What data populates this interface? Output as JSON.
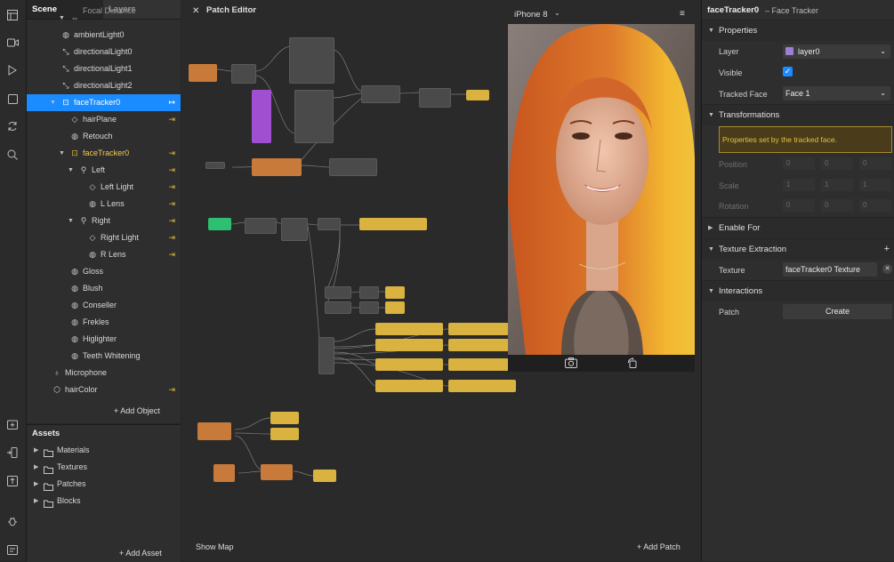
{
  "scene_panel": {
    "tabs": [
      "Scene",
      "Layers"
    ],
    "items": [
      {
        "label": "Focal Distance",
        "icon": "focal-icon"
      },
      {
        "label": "ambientLight0",
        "icon": "globe-icon"
      },
      {
        "label": "directionalLight0",
        "icon": "light-icon"
      },
      {
        "label": "directionalLight1",
        "icon": "light-icon"
      },
      {
        "label": "directionalLight2",
        "icon": "light-icon"
      },
      {
        "label": "faceTracker0",
        "icon": "face-tracker-icon"
      },
      {
        "label": "hairPlane",
        "icon": "plane-icon"
      },
      {
        "label": "Retouch",
        "icon": "globe-icon"
      },
      {
        "label": "faceTracker0",
        "icon": "face-tracker-icon"
      },
      {
        "label": "Left",
        "icon": "null-object-icon"
      },
      {
        "label": "Left Light",
        "icon": "plane-icon"
      },
      {
        "label": "L Lens",
        "icon": "globe-icon"
      },
      {
        "label": "Right",
        "icon": "null-object-icon"
      },
      {
        "label": "Right Light",
        "icon": "plane-icon"
      },
      {
        "label": "R Lens",
        "icon": "globe-icon"
      },
      {
        "label": "Gloss",
        "icon": "globe-icon"
      },
      {
        "label": "Blush",
        "icon": "globe-icon"
      },
      {
        "label": "Conseller",
        "icon": "globe-icon"
      },
      {
        "label": "Frekles",
        "icon": "globe-icon"
      },
      {
        "label": "Higlighter",
        "icon": "globe-icon"
      },
      {
        "label": "Teeth Whitening",
        "icon": "globe-icon"
      },
      {
        "label": "Microphone",
        "icon": "microphone-icon"
      },
      {
        "label": "hairColor",
        "icon": "cube-icon"
      }
    ],
    "add_object": "+ Add Object"
  },
  "assets_panel": {
    "title": "Assets",
    "folders": [
      "Materials",
      "Textures",
      "Patches",
      "Blocks"
    ],
    "add_asset": "+ Add Asset"
  },
  "patch_editor": {
    "title": "Patch Editor",
    "show_map": "Show Map",
    "add_patch": "+ Add Patch"
  },
  "preview": {
    "device": "iPhone 8",
    "colors": {
      "hair": "#d9762f",
      "hair_highlight": "#f2b52c",
      "skin": "#e9b9a0",
      "background": "#5a4a44"
    }
  },
  "inspector": {
    "object_name": "faceTracker0",
    "object_type": "– Face Tracker",
    "sections": {
      "properties": "Properties",
      "transformations": "Transformations",
      "enable_for": "Enable For",
      "texture_extraction": "Texture Extraction",
      "interactions": "Interactions"
    },
    "layer_label": "Layer",
    "layer_value": "layer0",
    "visible_label": "Visible",
    "visible_checked": true,
    "tracked_face_label": "Tracked Face",
    "tracked_face_value": "Face 1",
    "notice": "Properties set by the tracked face.",
    "position_label": "Position",
    "scale_label": "Scale",
    "rotation_label": "Rotation",
    "position_values": [
      "0",
      "0",
      "0"
    ],
    "scale_values": [
      "1",
      "1",
      "1"
    ],
    "rotation_values": [
      "0",
      "0",
      "0"
    ],
    "texture_label": "Texture",
    "texture_value": "faceTracker0 Texture",
    "patch_label": "Patch",
    "create_button": "Create",
    "accent": "#1a8cff",
    "notice_border": "#a88a2a"
  }
}
